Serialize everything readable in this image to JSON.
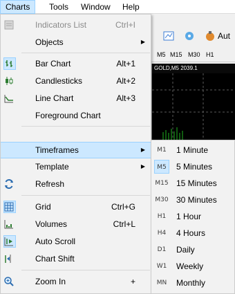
{
  "menubar": {
    "charts": "Charts",
    "tools": "Tools",
    "window": "Window",
    "help": "Help"
  },
  "background": {
    "timeframes": [
      "M5",
      "M15",
      "M30",
      "H1"
    ],
    "toolbar_text": "Aut",
    "chart_title": "GOLD,M5  2039.1"
  },
  "charts_menu": {
    "items": [
      {
        "icon": "indicators-list-icon",
        "label": "Indicators List",
        "shortcut": "Ctrl+I",
        "disabled": true
      },
      {
        "label": "Objects",
        "submenu": true
      },
      {
        "icon": "bar-chart-icon",
        "label": "Bar Chart",
        "shortcut": "Alt+1",
        "checked": true
      },
      {
        "icon": "candlesticks-icon",
        "label": "Candlesticks",
        "shortcut": "Alt+2"
      },
      {
        "icon": "line-chart-icon",
        "label": "Line Chart",
        "shortcut": "Alt+3"
      },
      {
        "label": "Foreground Chart"
      },
      {
        "label": "Timeframes",
        "submenu": true,
        "highlighted": true
      },
      {
        "label": "Template",
        "submenu": true
      },
      {
        "icon": "refresh-icon",
        "label": "Refresh"
      },
      {
        "icon": "grid-icon",
        "label": "Grid",
        "shortcut": "Ctrl+G",
        "checked": true
      },
      {
        "icon": "volumes-icon",
        "label": "Volumes",
        "shortcut": "Ctrl+L"
      },
      {
        "icon": "auto-scroll-icon",
        "label": "Auto Scroll",
        "checked": true
      },
      {
        "icon": "chart-shift-icon",
        "label": "Chart Shift"
      },
      {
        "icon": "zoom-in-icon",
        "label": "Zoom In",
        "shortcut": "+"
      }
    ]
  },
  "timeframes_menu": {
    "items": [
      {
        "code": "M1",
        "label": "1 Minute"
      },
      {
        "code": "M5",
        "label": "5 Minutes",
        "checked": true
      },
      {
        "code": "M15",
        "label": "15 Minutes"
      },
      {
        "code": "M30",
        "label": "30 Minutes"
      },
      {
        "code": "H1",
        "label": "1 Hour"
      },
      {
        "code": "H4",
        "label": "4 Hours"
      },
      {
        "code": "D1",
        "label": "Daily"
      },
      {
        "code": "W1",
        "label": "Weekly"
      },
      {
        "code": "MN",
        "label": "Monthly"
      }
    ]
  }
}
